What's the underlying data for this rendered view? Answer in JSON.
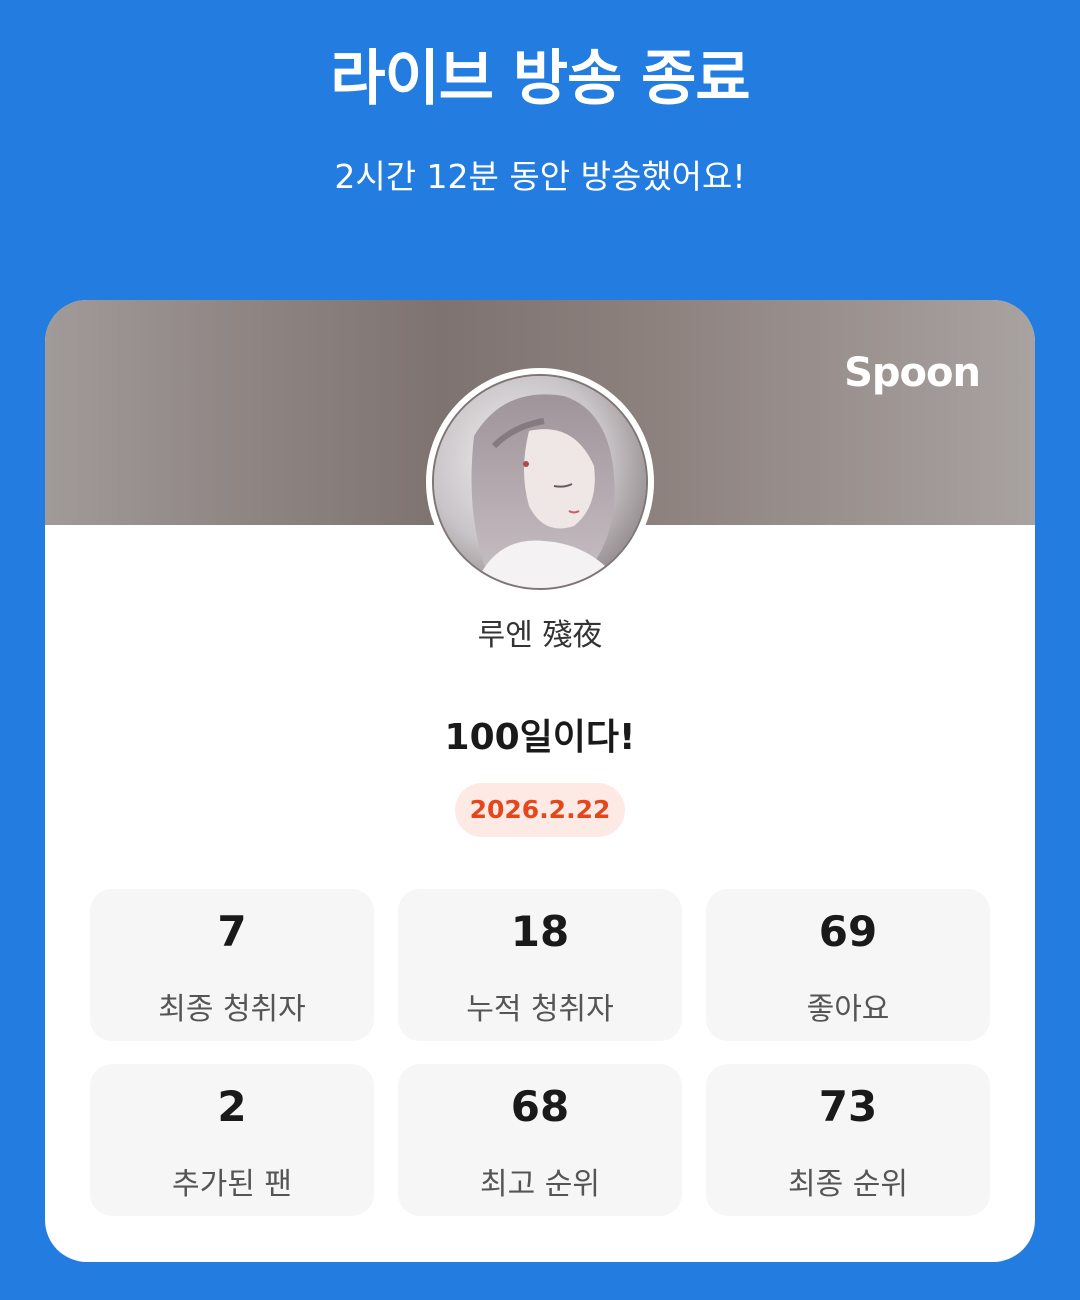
{
  "header": {
    "title": "라이브 방송 종료",
    "subtitle": "2시간 12분 동안 방송했어요!"
  },
  "card": {
    "brand": "Spoon",
    "nickname": "루엔 殘夜",
    "live_title": "100일이다!",
    "date": "2026.2.22"
  },
  "stats": [
    {
      "value": "7",
      "label": "최종 청취자"
    },
    {
      "value": "18",
      "label": "누적 청취자"
    },
    {
      "value": "69",
      "label": "좋아요"
    },
    {
      "value": "2",
      "label": "추가된 팬"
    },
    {
      "value": "68",
      "label": "최고 순위"
    },
    {
      "value": "73",
      "label": "최종 순위"
    }
  ],
  "colors": {
    "background": "#237de0",
    "date_text": "#e5461c",
    "date_pill": "#fdeae4"
  }
}
